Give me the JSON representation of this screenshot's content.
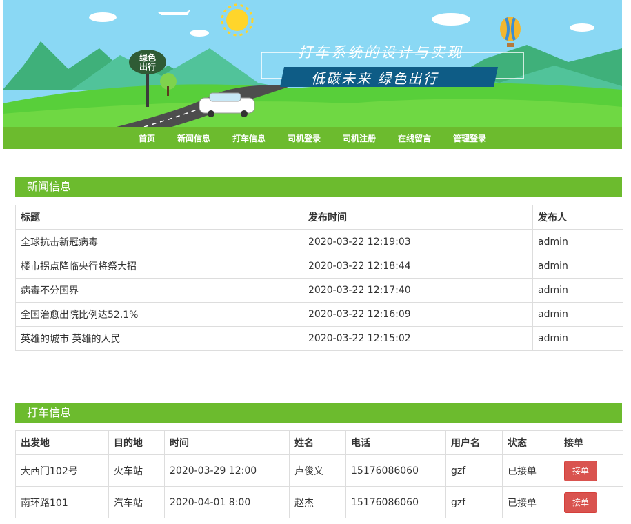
{
  "banner": {
    "sign_text_1": "绿色",
    "sign_text_2": "出行",
    "title": "打车系统的设计与实现",
    "slogan": "低碳未来  绿色出行"
  },
  "nav": {
    "items": [
      "首页",
      "新闻信息",
      "打车信息",
      "司机登录",
      "司机注册",
      "在线留言",
      "管理登录"
    ]
  },
  "news": {
    "heading": "新闻信息",
    "columns": [
      "标题",
      "发布时间",
      "发布人"
    ],
    "rows": [
      [
        "全球抗击新冠病毒",
        "2020-03-22 12:19:03",
        "admin"
      ],
      [
        "楼市拐点降临央行将祭大招",
        "2020-03-22 12:18:44",
        "admin"
      ],
      [
        "病毒不分国界",
        "2020-03-22 12:17:40",
        "admin"
      ],
      [
        "全国治愈出院比例达52.1%",
        "2020-03-22 12:16:09",
        "admin"
      ],
      [
        "英雄的城市 英雄的人民",
        "2020-03-22 12:15:02",
        "admin"
      ]
    ]
  },
  "taxi": {
    "heading": "打车信息",
    "columns": [
      "出发地",
      "目的地",
      "时间",
      "姓名",
      "电话",
      "用户名",
      "状态",
      "接单"
    ],
    "rows": [
      [
        "大西门102号",
        "火车站",
        "2020-03-29 12:00",
        "卢俊义",
        "15176086060",
        "gzf",
        "已接单",
        "接单"
      ],
      [
        "南环路101",
        "汽车站",
        "2020-04-01 8:00",
        "赵杰",
        "15176086060",
        "gzf",
        "已接单",
        "接单"
      ]
    ]
  },
  "colors": {
    "accent": "#6cbb2e",
    "danger": "#d9534f",
    "sky": "#8ad8f4"
  }
}
